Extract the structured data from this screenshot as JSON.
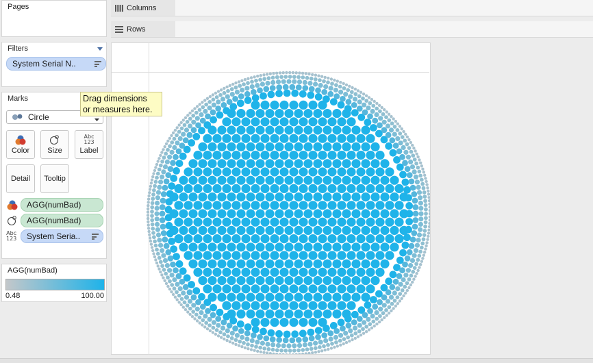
{
  "pages": {
    "title": "Pages"
  },
  "filters": {
    "title": "Filters",
    "pill": "System Serial N.."
  },
  "marks": {
    "title": "Marks",
    "mark_type": "Circle",
    "buttons": {
      "color": "Color",
      "size": "Size",
      "label": "Label",
      "detail": "Detail",
      "tooltip": "Tooltip"
    },
    "fields": {
      "color": "AGG(numBad)",
      "size": "AGG(numBad)",
      "label": "System Seria.."
    },
    "abc_top": "Abc",
    "abc_bottom": "123"
  },
  "legend": {
    "title": "AGG(numBad)",
    "min": "0.48",
    "max": "100.00",
    "color_low": "#c3c7ca",
    "color_high": "#1fb3e9"
  },
  "shelves": {
    "columns": "Columns",
    "rows": "Rows"
  },
  "tooltip": {
    "line1": "Drag dimensions",
    "line2": "or measures here."
  },
  "viz": {
    "mark_color_high": "#1fb3e9",
    "mark_color_low": "#8fbfd1"
  }
}
